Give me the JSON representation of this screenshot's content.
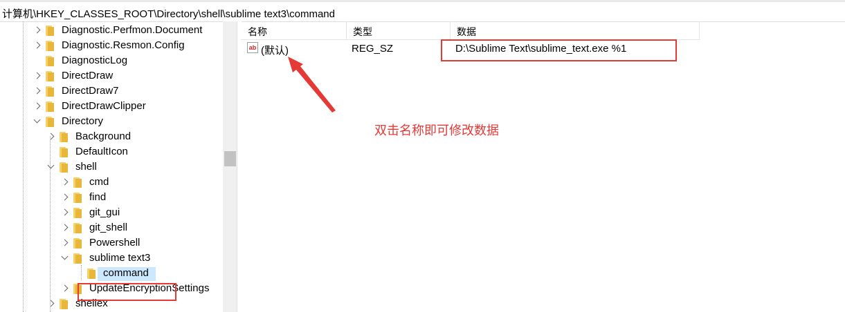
{
  "address_bar": {
    "path": "计算机\\HKEY_CLASSES_ROOT\\Directory\\shell\\sublime text3\\command"
  },
  "tree": {
    "items": [
      {
        "label": "Diagnostic.Perfmon.Document",
        "expander": "collapsed"
      },
      {
        "label": "Diagnostic.Resmon.Config",
        "expander": "collapsed"
      },
      {
        "label": "DiagnosticLog",
        "expander": "none"
      },
      {
        "label": "DirectDraw",
        "expander": "collapsed"
      },
      {
        "label": "DirectDraw7",
        "expander": "collapsed"
      },
      {
        "label": "DirectDrawClipper",
        "expander": "collapsed"
      },
      {
        "label": "Directory",
        "expander": "expanded"
      },
      {
        "label": "Background",
        "expander": "collapsed"
      },
      {
        "label": "DefaultIcon",
        "expander": "none"
      },
      {
        "label": "shell",
        "expander": "expanded"
      },
      {
        "label": "cmd",
        "expander": "collapsed"
      },
      {
        "label": "find",
        "expander": "collapsed"
      },
      {
        "label": "git_gui",
        "expander": "collapsed"
      },
      {
        "label": "git_shell",
        "expander": "collapsed"
      },
      {
        "label": "Powershell",
        "expander": "collapsed"
      },
      {
        "label": "sublime text3",
        "expander": "expanded"
      },
      {
        "label": "command",
        "expander": "none",
        "selected": true
      },
      {
        "label": "UpdateEncryptionSettings",
        "expander": "collapsed"
      },
      {
        "label": "shellex",
        "expander": "collapsed"
      }
    ]
  },
  "values_list": {
    "columns": [
      "名称",
      "类型",
      "数据"
    ],
    "rows": [
      {
        "name": "(默认)",
        "type": "REG_SZ",
        "data": "D:\\Sublime Text\\sublime_text.exe %1",
        "icon": "string-value-icon"
      }
    ]
  },
  "annotation": {
    "text": "双击名称即可修改数据",
    "color": "#e53935"
  },
  "colors": {
    "highlight": "#e53935",
    "selection": "#cce8ff",
    "folder": "#f5d06b"
  }
}
